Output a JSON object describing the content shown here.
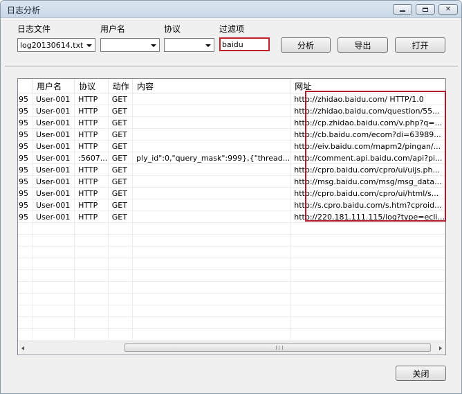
{
  "window": {
    "title": "日志分析"
  },
  "filters": {
    "log_file_label": "日志文件",
    "log_file_value": "log20130614.txt",
    "username_label": "用户名",
    "username_value": "",
    "protocol_label": "协议",
    "protocol_value": "",
    "filter_label": "过滤项",
    "filter_value": "baidu"
  },
  "buttons": {
    "analyze": "分析",
    "export": "导出",
    "open": "打开",
    "close": "关闭"
  },
  "table": {
    "columns": [
      "",
      "用户名",
      "协议",
      "动作",
      "内容",
      "网址"
    ],
    "rows": [
      [
        "95",
        "User-001",
        "HTTP",
        "GET",
        "",
        "http://zhidao.baidu.com/ HTTP/1.0"
      ],
      [
        "95",
        "User-001",
        "HTTP",
        "GET",
        "",
        "http://zhidao.baidu.com/question/55..."
      ],
      [
        "95",
        "User-001",
        "HTTP",
        "GET",
        "",
        "http://cp.zhidao.baidu.com/v.php?q=..."
      ],
      [
        "95",
        "User-001",
        "HTTP",
        "GET",
        "",
        "http://cb.baidu.com/ecom?di=63989..."
      ],
      [
        "95",
        "User-001",
        "HTTP",
        "GET",
        "",
        "http://eiv.baidu.com/mapm2/pingan/..."
      ],
      [
        "95",
        "User-001",
        ":5607...",
        "GET",
        "ply_id\":0,\"query_mask\":999},{\"thread...",
        "http://comment.api.baidu.com/api?pi..."
      ],
      [
        "95",
        "User-001",
        "HTTP",
        "GET",
        "",
        "http://cpro.baidu.com/cpro/ui/uijs.ph..."
      ],
      [
        "95",
        "User-001",
        "HTTP",
        "GET",
        "",
        "http://msg.baidu.com/msg/msg_data..."
      ],
      [
        "95",
        "User-001",
        "HTTP",
        "GET",
        "",
        "http://cpro.baidu.com/cpro/ui/html/s..."
      ],
      [
        "95",
        "User-001",
        "HTTP",
        "GET",
        "",
        "http://s.cpro.baidu.com/s.htm?cproid..."
      ],
      [
        "95",
        "User-001",
        "HTTP",
        "GET",
        "",
        "http://220.181.111.115/log?type=ecli..."
      ]
    ],
    "empty_rows": 10
  }
}
